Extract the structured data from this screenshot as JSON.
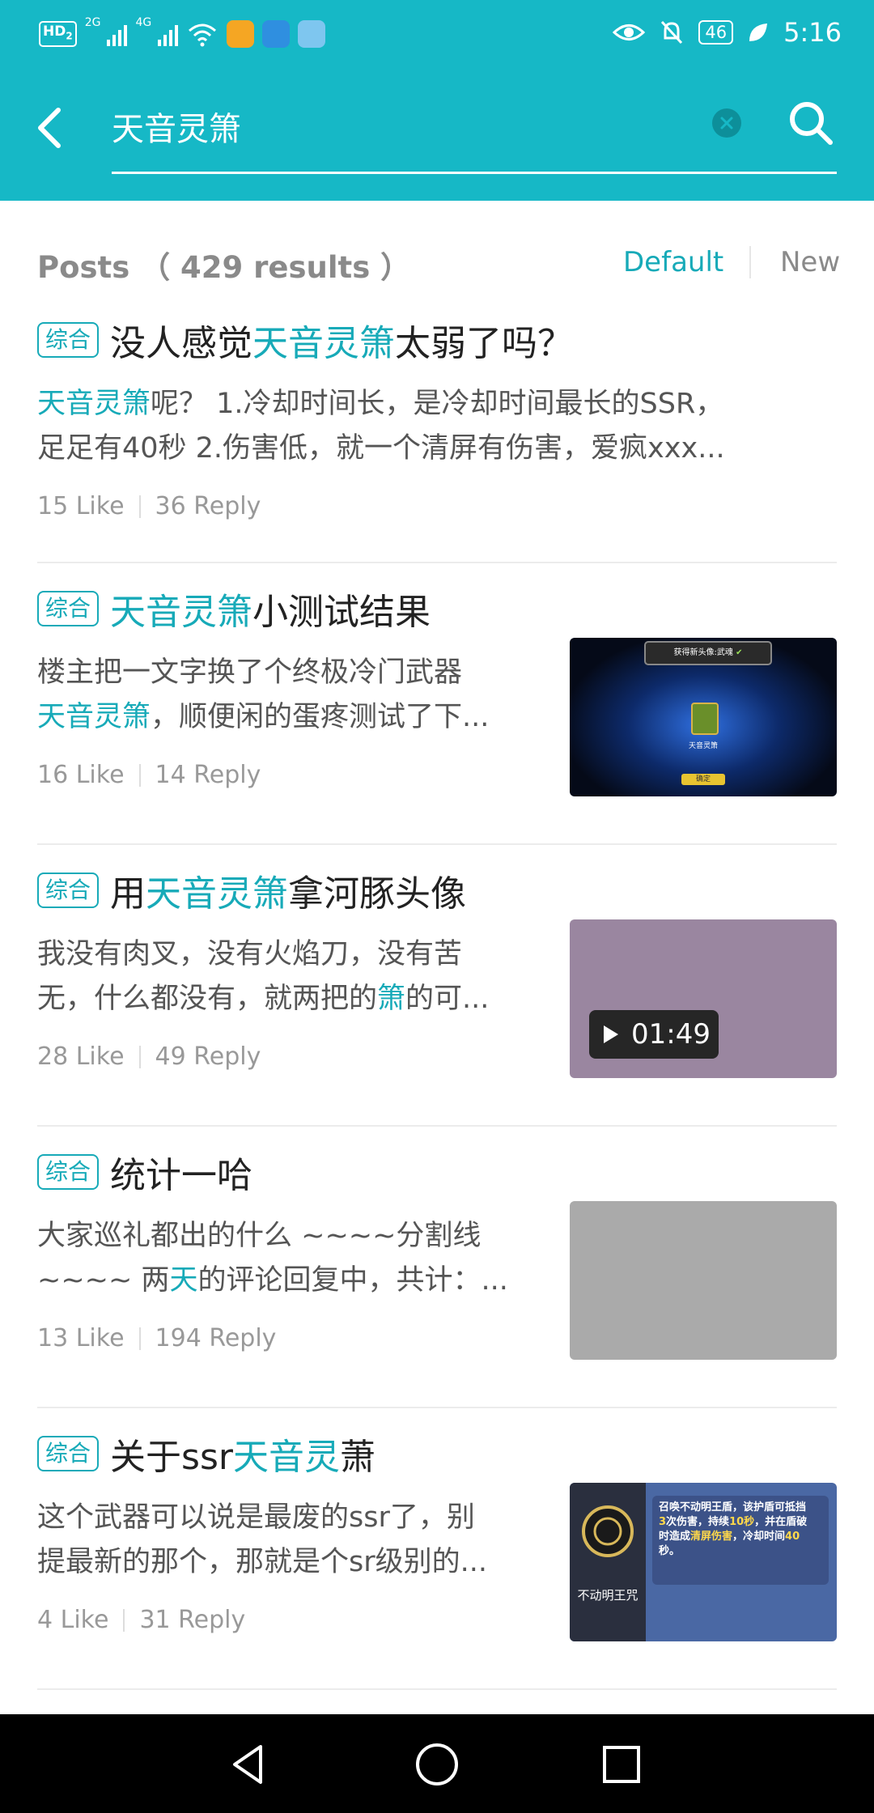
{
  "status_bar": {
    "hd": "HD",
    "hd_sub": "2",
    "net1": "2G",
    "net2": "4G",
    "battery": "46",
    "time": "5:16"
  },
  "search": {
    "query": "天音灵箫"
  },
  "results": {
    "title": "Posts",
    "count": "（ 429 results ）",
    "sort_default": "Default",
    "sort_new": "New"
  },
  "posts": [
    {
      "tag": "综合",
      "title": [
        {
          "t": "没人感觉",
          "h": false
        },
        {
          "t": "天音灵箫",
          "h": true
        },
        {
          "t": "太弱了吗？",
          "h": false
        }
      ],
      "body": [
        [
          {
            "t": "天音灵箫",
            "h": true
          },
          {
            "t": "呢？ 1.冷却时间长，是冷却时间最长的SSR，",
            "h": false
          }
        ],
        [
          {
            "t": "足足有40秒 2.伤害低，就一个清屏有伤害，爱疯xxx...",
            "h": false
          }
        ]
      ],
      "likes": "15 Like",
      "replies": "36 Reply",
      "thumb": "none"
    },
    {
      "tag": "综合",
      "title": [
        {
          "t": "天音灵箫",
          "h": true
        },
        {
          "t": "小测试结果",
          "h": false
        }
      ],
      "body": [
        [
          {
            "t": "楼主把一文字换了个终极冷门武器",
            "h": false
          }
        ],
        [
          {
            "t": "天音灵箫",
            "h": true
          },
          {
            "t": "，顺便闲的蛋疼测试了下...",
            "h": false
          }
        ]
      ],
      "likes": "16 Like",
      "replies": "14 Reply",
      "thumb": "game-screenshot"
    },
    {
      "tag": "综合",
      "title": [
        {
          "t": "用",
          "h": false
        },
        {
          "t": "天音灵箫",
          "h": true
        },
        {
          "t": "拿河豚头像",
          "h": false
        }
      ],
      "body": [
        [
          {
            "t": "我没有肉叉，没有火焰刀，没有苦",
            "h": false
          }
        ],
        [
          {
            "t": "无，什么都没有，就两把的",
            "h": false
          },
          {
            "t": "箫",
            "h": true
          },
          {
            "t": "的可...",
            "h": false
          }
        ]
      ],
      "likes": "28 Like",
      "replies": "49 Reply",
      "thumb": "video",
      "video_duration": "01:49",
      "thumb_color": "#9a86a0"
    },
    {
      "tag": "综合",
      "title": [
        {
          "t": "统计一哈",
          "h": false
        }
      ],
      "body": [
        [
          {
            "t": "大家巡礼都出的什么 ~~~~分割线",
            "h": false
          }
        ],
        [
          {
            "t": "~~~~ 两",
            "h": false
          },
          {
            "t": "天",
            "h": true
          },
          {
            "t": "的评论回复中，共计：...",
            "h": false
          }
        ]
      ],
      "likes": "13 Like",
      "replies": "194 Reply",
      "thumb": "blank",
      "thumb_color": "#aaaaaa"
    },
    {
      "tag": "综合",
      "title": [
        {
          "t": "关于ssr",
          "h": false
        },
        {
          "t": "天音灵",
          "h": true
        },
        {
          "t": "萧",
          "h": false
        }
      ],
      "body": [
        [
          {
            "t": "这个武器可以说是最废的ssr了，别",
            "h": false
          }
        ],
        [
          {
            "t": "提最新的那个，那就是个sr级别的...",
            "h": false
          }
        ]
      ],
      "likes": "4 Like",
      "replies": "31 Reply",
      "thumb": "skill-card",
      "skill_name": "不动明王咒",
      "skill_desc": [
        [
          {
            "t": "召唤不动明王盾，该护盾可抵挡",
            "y": false
          }
        ],
        [
          {
            "t": "3",
            "y": true
          },
          {
            "t": "次伤害，持续",
            "y": false
          },
          {
            "t": "10秒",
            "y": true
          },
          {
            "t": "，并在盾破",
            "y": false
          }
        ],
        [
          {
            "t": "时造成",
            "y": false
          },
          {
            "t": "清屏伤害",
            "y": true
          },
          {
            "t": "，冷却时间",
            "y": false
          },
          {
            "t": "40",
            "y": true
          }
        ],
        [
          {
            "t": "秒。",
            "y": false
          }
        ]
      ],
      "game_confirm": "确定",
      "game_banner": "获得新头像:武魂",
      "game_weapon": "天音灵箫"
    }
  ],
  "colors": {
    "accent": "#16b8c6",
    "highlight": "#17aab8"
  }
}
